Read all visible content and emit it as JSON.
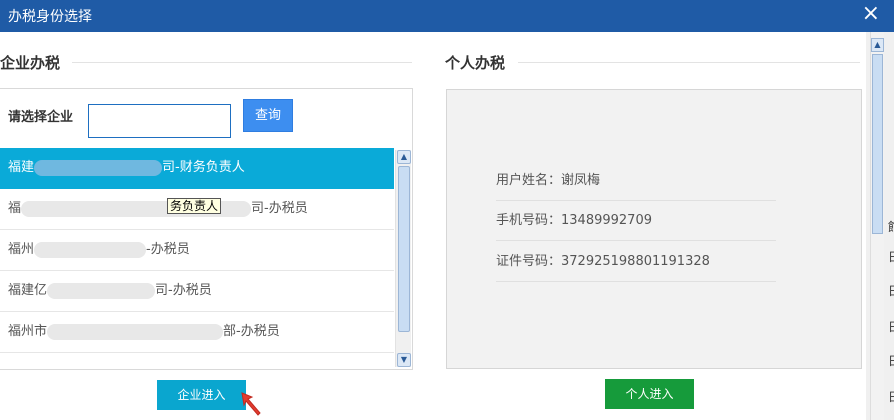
{
  "dialog": {
    "title": "办税身份选择",
    "close_symbol": "×"
  },
  "enterprise": {
    "section_title": "企业办税",
    "search_label": "请选择企业",
    "search_value": "",
    "query_button": "查询",
    "items": [
      {
        "prefix": "福建",
        "suffix": "司-财务负责人",
        "selected": true
      },
      {
        "prefix": "福",
        "suffix": "司-办税员",
        "selected": false
      },
      {
        "prefix": "福州",
        "suffix": "-办税员",
        "selected": false
      },
      {
        "prefix": "福建亿",
        "suffix": "司-办税员",
        "selected": false
      },
      {
        "prefix": "福州市",
        "suffix": "部-办税员",
        "selected": false
      }
    ],
    "tooltip": "务负责人",
    "enter_button": "企业进入"
  },
  "personal": {
    "section_title": "个人办税",
    "name_row": "用户姓名：谢凤梅",
    "phone_row": "手机号码：13489992709",
    "id_row": "证件号码：372925198801191328",
    "enter_button": "个人进入"
  },
  "colors": {
    "titlebar": "#1f5ba6",
    "selected_row": "#0aaad8",
    "enterprise_button": "#0aa6cf",
    "personal_button": "#169b3b",
    "query_button": "#3d8ef0"
  },
  "edge": {
    "chars": [
      "館",
      "日",
      "日",
      "日",
      "日",
      "日"
    ]
  }
}
